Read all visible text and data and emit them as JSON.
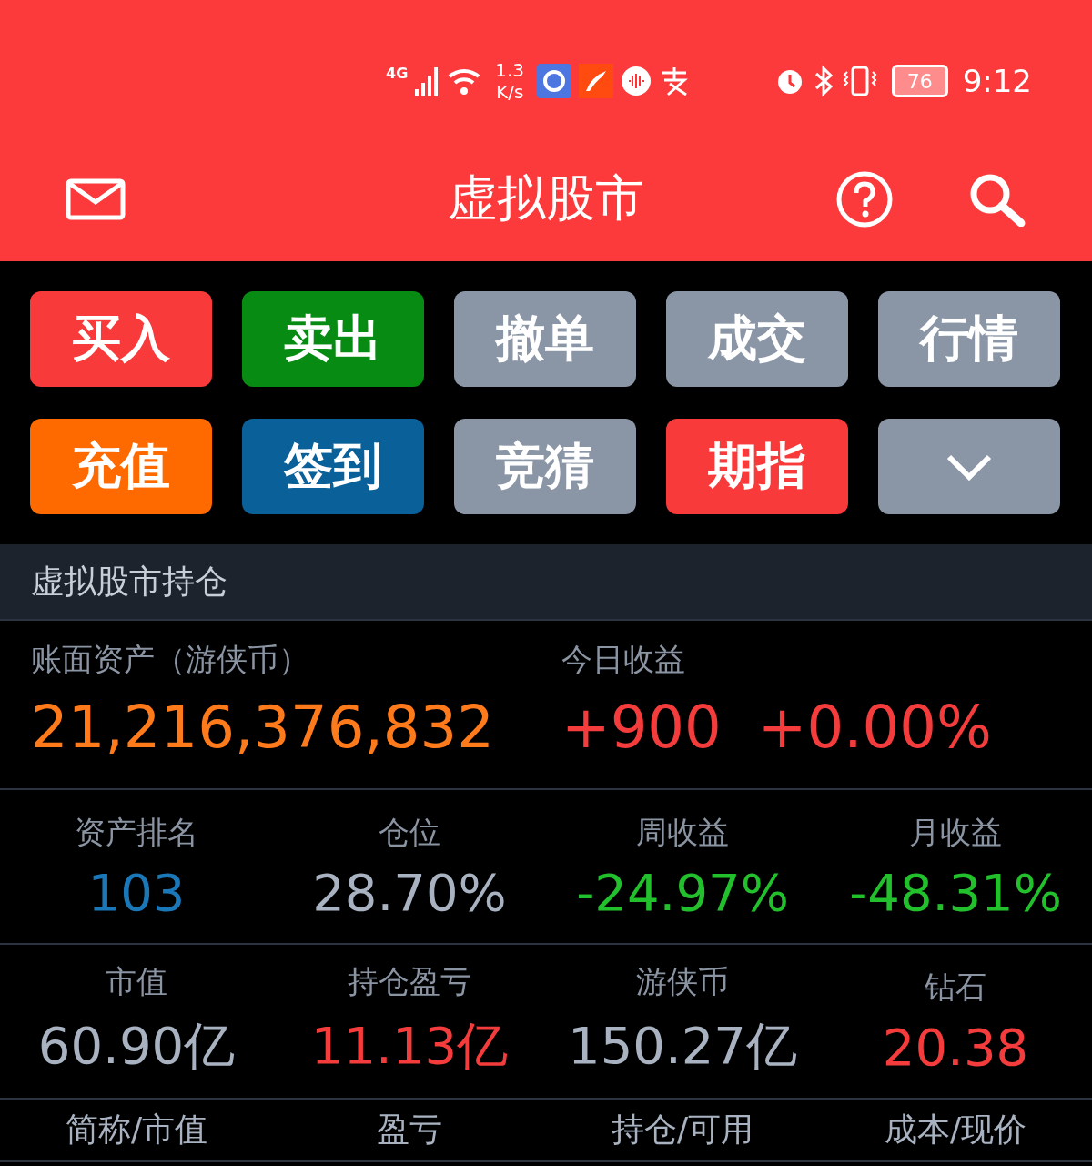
{
  "status_bar": {
    "network": "4G",
    "speed_value": "1.3",
    "speed_unit": "K/s",
    "battery": "76",
    "time": "9:12"
  },
  "header": {
    "title": "虚拟股市"
  },
  "actions": [
    {
      "label": "买入",
      "color": "#f83a3b"
    },
    {
      "label": "卖出",
      "color": "#078b12"
    },
    {
      "label": "撤单",
      "color": "#8a96a6"
    },
    {
      "label": "成交",
      "color": "#8a96a6"
    },
    {
      "label": "行情",
      "color": "#8a96a6"
    },
    {
      "label": "充值",
      "color": "#ff6a00"
    },
    {
      "label": "签到",
      "color": "#0a6099"
    },
    {
      "label": "竞猜",
      "color": "#8a96a6"
    },
    {
      "label": "期指",
      "color": "#f83a3b"
    }
  ],
  "section_title": "虚拟股市持仓",
  "assets": {
    "label": "账面资产（游侠币）",
    "value": "21,216,376,832",
    "today_label": "今日收益",
    "today_amount": "+900",
    "today_percent": "+0.00%"
  },
  "stats": [
    {
      "label": "资产排名",
      "value": "103",
      "color": "#1a78b8"
    },
    {
      "label": "仓位",
      "value": "28.70%",
      "color": "#a8b2c0"
    },
    {
      "label": "周收益",
      "value": "-24.97%",
      "color": "#22c02c"
    },
    {
      "label": "月收益",
      "value": "-48.31%",
      "color": "#22c02c"
    },
    {
      "label": "市值",
      "value": "60.90亿",
      "color": "#a8b2c0"
    },
    {
      "label": "持仓盈亏",
      "value": "11.13亿",
      "color": "#f43c3c"
    },
    {
      "label": "游侠币",
      "value": "150.27亿",
      "color": "#a8b2c0"
    },
    {
      "label": "钻石",
      "value": "20.38",
      "color": "#f43c3c"
    }
  ],
  "table": {
    "columns": [
      "简称/市值",
      "盈亏",
      "持仓/可用",
      "成本/现价"
    ]
  }
}
